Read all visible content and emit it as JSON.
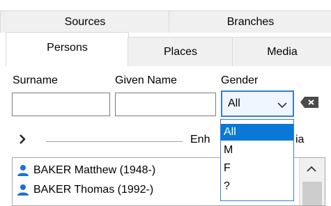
{
  "tabs_row1": [
    "Sources",
    "Branches"
  ],
  "tabs_row2": [
    "Persons",
    "Places",
    "Media"
  ],
  "fields": {
    "surname_label": "Surname",
    "given_name_label": "Given Name",
    "gender_label": "Gender",
    "surname_value": "",
    "given_name_value": ""
  },
  "gender": {
    "selected": "All",
    "options": [
      "All",
      "M",
      "F",
      "?"
    ]
  },
  "enhanced": {
    "text": "Enh",
    "tail": "ia"
  },
  "list": {
    "rows": [
      "BAKER Matthew (1948-)",
      "BAKER Thomas (1992-)"
    ]
  },
  "colors": {
    "accent": "#0a78d7",
    "person_icon": "#1e6fd9"
  },
  "icons": {
    "expander": "chevron-right-icon",
    "clear": "backspace-icon",
    "dropdown": "chevron-down-icon",
    "person": "person-icon",
    "scroll_up": "chevron-up-icon"
  }
}
